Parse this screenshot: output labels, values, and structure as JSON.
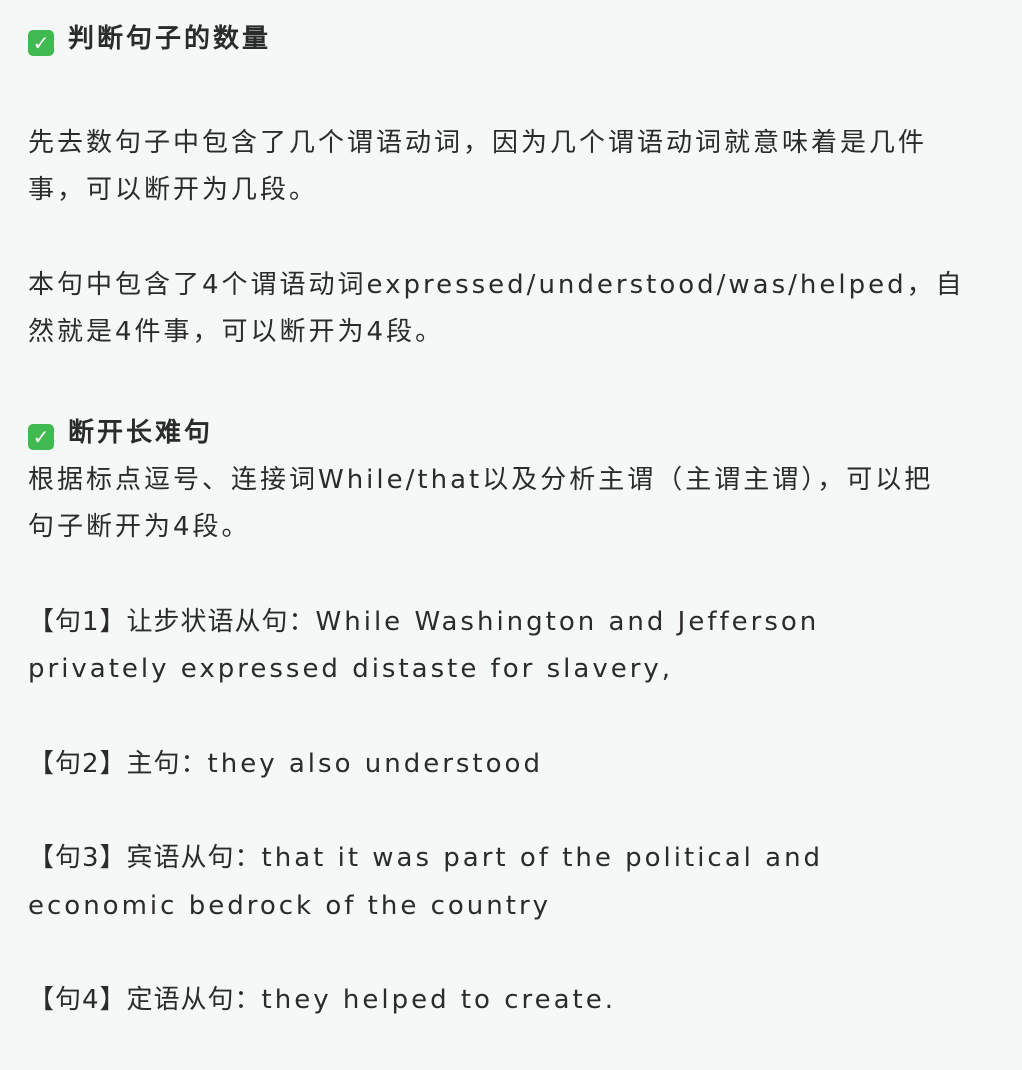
{
  "section1": {
    "icon": "check-mark-icon",
    "title": "判断句子的数量",
    "para1_line1": "先去数句子中包含了几个谓语动词，因为几个谓语动词就意味着是几件",
    "para1_line2": "事，可以断开为几段。",
    "para2_line1": "本句中包含了4个谓语动词expressed/understood/was/helped，自",
    "para2_line2": "然就是4件事，可以断开为4段。"
  },
  "section2": {
    "icon": "check-mark-icon",
    "title": "断开长难句",
    "intro_line1": "根据标点逗号、连接词While/that以及分析主谓（主谓主谓），可以把",
    "intro_line2": "句子断开为4段。",
    "clauses": [
      {
        "label": "【句1】让步状语从句：",
        "line1": "While Washington and Jefferson",
        "line2": "privately expressed distaste for slavery,"
      },
      {
        "label": "【句2】主句：",
        "line1": "they also understood"
      },
      {
        "label": "【句3】宾语从句：",
        "line1": "that it was part of the political and",
        "line2": "economic bedrock of the country"
      },
      {
        "label": "【句4】定语从句：",
        "line1": "they helped to create."
      }
    ]
  },
  "colors": {
    "background": "#f4f8f6",
    "text": "#2b2b2b",
    "check": "#3fb950"
  }
}
